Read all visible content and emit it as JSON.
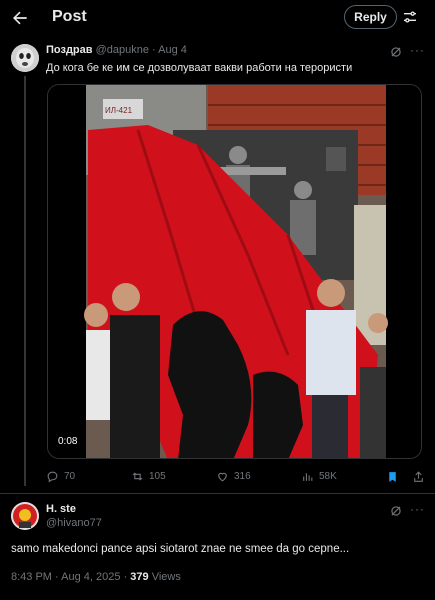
{
  "header": {
    "title": "Post",
    "reply_label": "Reply"
  },
  "post": {
    "author_name": "Поздрав",
    "author_handle": "@dapukne",
    "separator": "·",
    "date": "Aug 4",
    "text": "До кога бе ке им се дозволуваат вакви работи на терористи",
    "media": {
      "video_timestamp": "0:08",
      "sign_text": "ИЛ-421"
    },
    "stats": {
      "replies": "70",
      "reposts": "105",
      "likes": "316",
      "views": "58K"
    },
    "colors": {
      "flag_red": "#d0101a",
      "bookmark_active": "#1d9bf0"
    }
  },
  "reply": {
    "author_name": "H. ste",
    "author_handle": "@hivano77",
    "text": "samo makedoncі pance apsi siotarot znae ne smee da go cepne...",
    "time": "8:43 PM",
    "date": "Aug 4, 2025",
    "views_count": "379",
    "views_label": "Views"
  }
}
